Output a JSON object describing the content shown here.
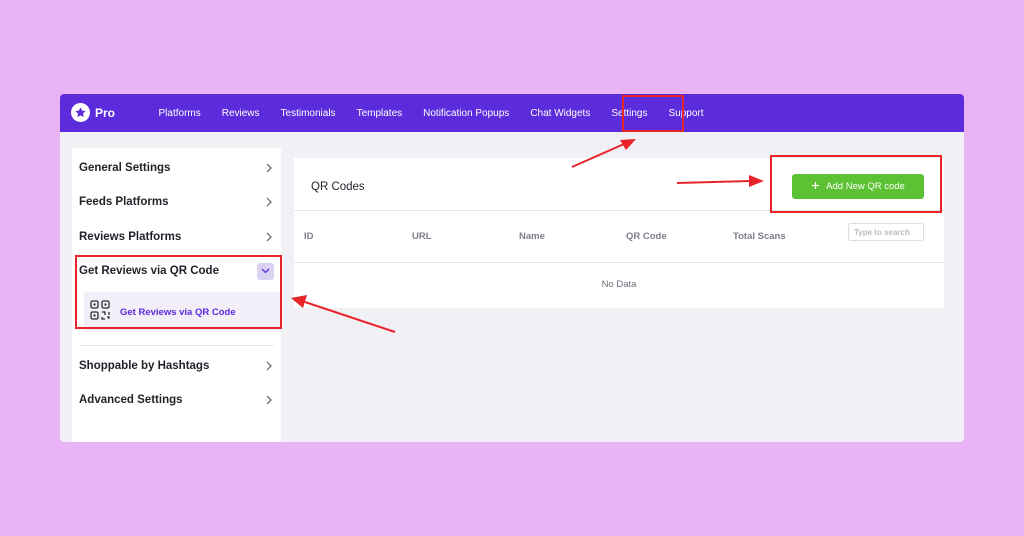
{
  "app": {
    "logo_text": "Pro"
  },
  "nav": {
    "items": [
      "Platforms",
      "Reviews",
      "Testimonials",
      "Templates",
      "Notification Popups",
      "Chat Widgets",
      "Settings",
      "Support"
    ]
  },
  "sidebar": {
    "items": [
      {
        "label": "General Settings"
      },
      {
        "label": "Feeds Platforms"
      },
      {
        "label": "Reviews Platforms"
      },
      {
        "label": "Get Reviews via QR Code"
      },
      {
        "label": "Shoppable by Hashtags"
      },
      {
        "label": "Advanced Settings"
      }
    ],
    "submenu": {
      "label": "Get Reviews via QR Code"
    }
  },
  "main": {
    "title": "QR Codes",
    "add_button": "Add New QR code",
    "table": {
      "headers": [
        "ID",
        "URL",
        "Name",
        "QR Code",
        "Total Scans"
      ],
      "search_placeholder": "Type to search",
      "empty_text": "No Data"
    }
  },
  "colors": {
    "background": "#e9b3f6",
    "topbar": "#5b2bdc",
    "accent_green": "#5cc234",
    "annotation_red": "#e8232a"
  }
}
